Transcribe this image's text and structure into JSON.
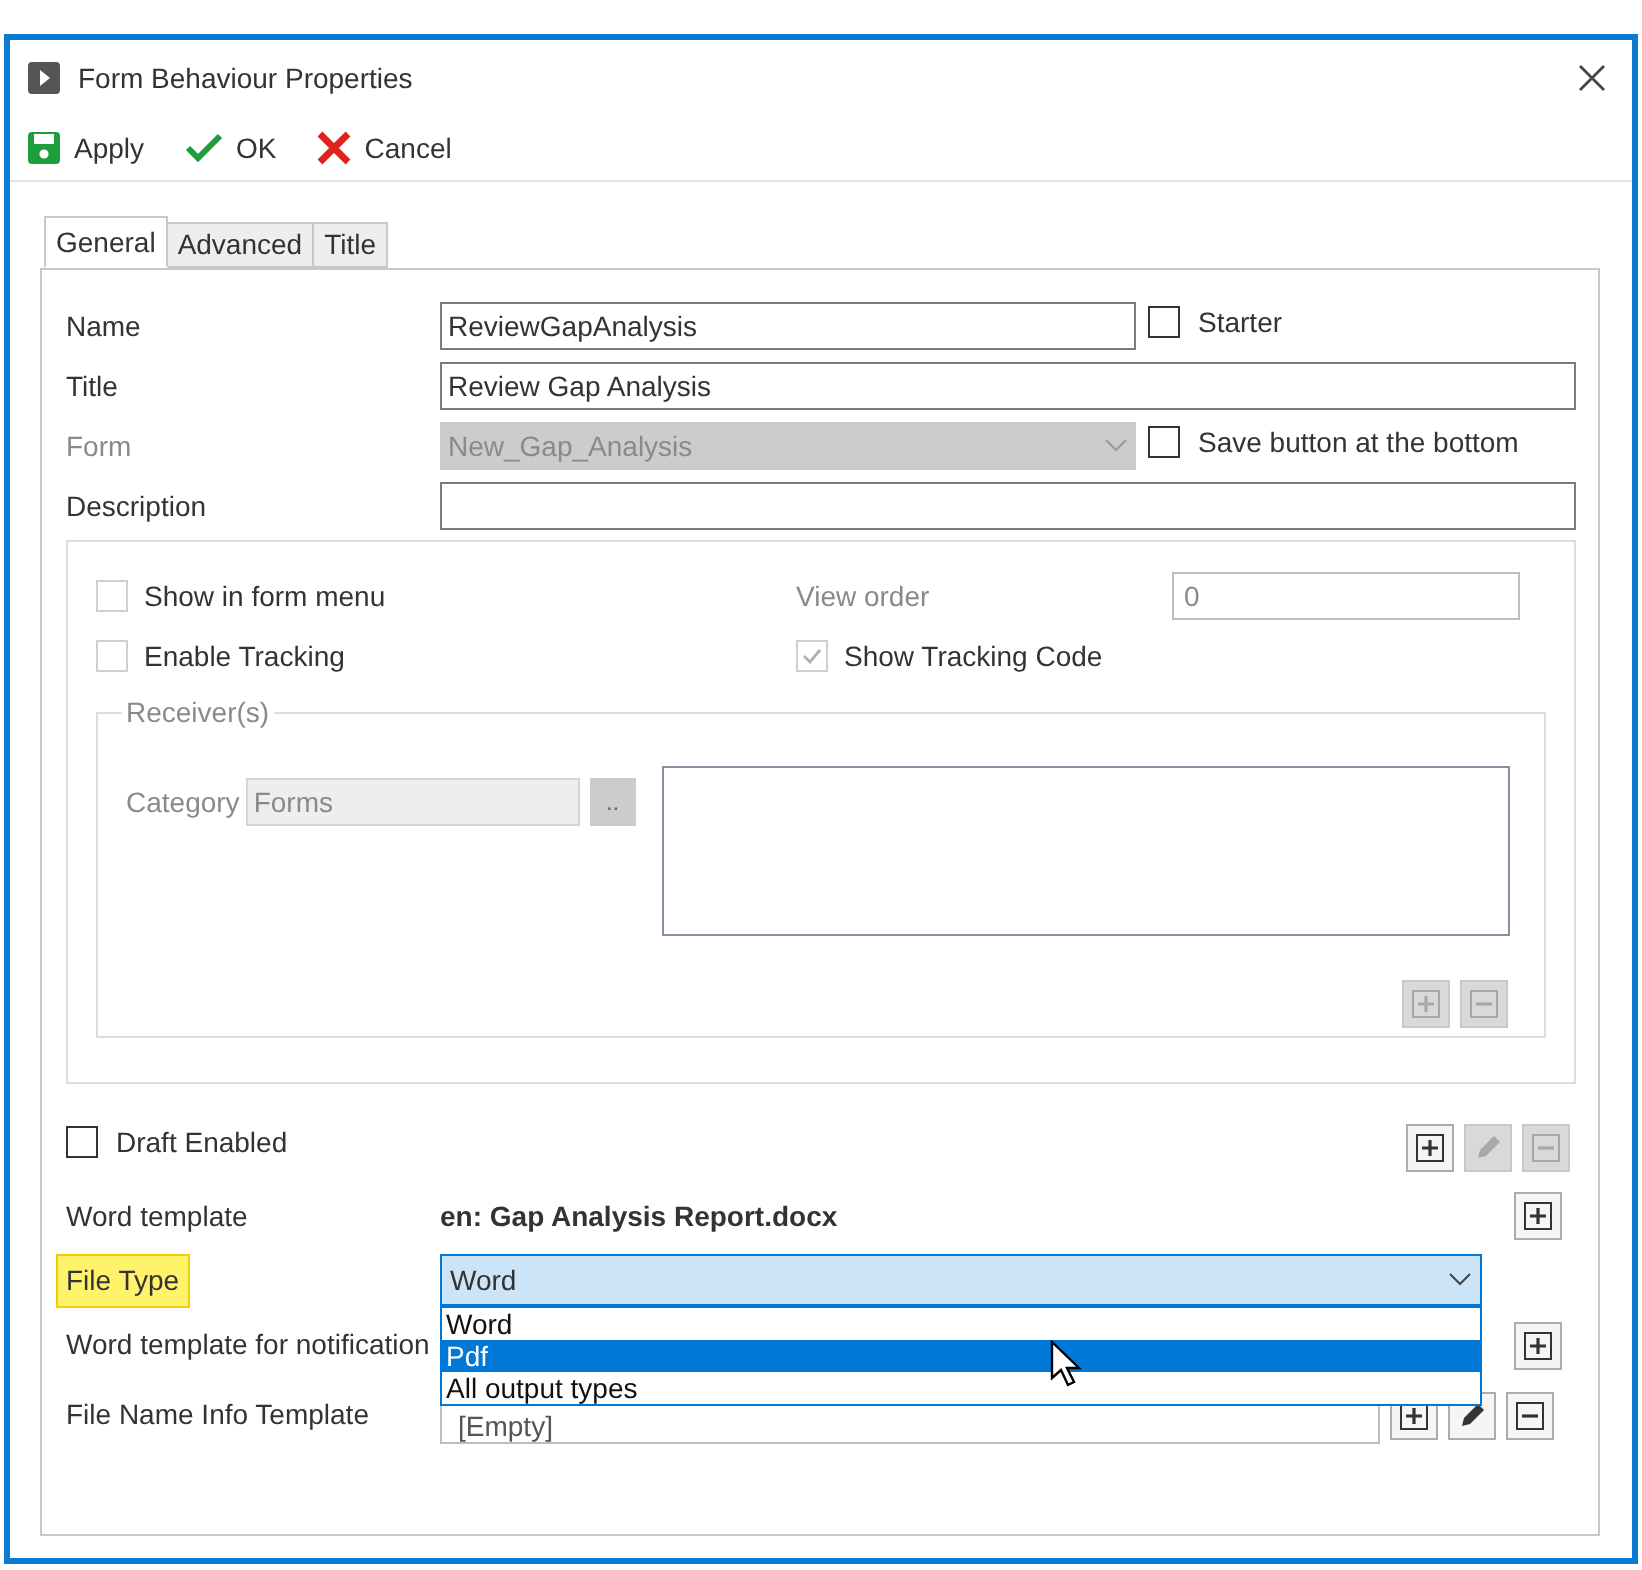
{
  "window": {
    "title": "Form Behaviour Properties"
  },
  "toolbar": [
    {
      "kind": "save",
      "label": "Apply"
    },
    {
      "kind": "ok",
      "label": "OK"
    },
    {
      "kind": "cancel",
      "label": "Cancel"
    }
  ],
  "tabs": [
    {
      "label": "General",
      "selected": true
    },
    {
      "label": "Advanced",
      "selected": false
    },
    {
      "label": "Title",
      "selected": false
    }
  ],
  "fields": [
    {
      "kind": "text",
      "label": "Name",
      "value": "ReviewGapAnalysis",
      "disabled": false,
      "checkbox": {
        "label": "Starter",
        "checked": false
      }
    },
    {
      "kind": "text",
      "label": "Title",
      "value": "Review Gap Analysis",
      "disabled": false
    },
    {
      "kind": "select",
      "label": "Form",
      "value": "New_Gap_Analysis",
      "disabled": true,
      "checkbox": {
        "label": "Save button at the bottom",
        "checked": false
      }
    },
    {
      "kind": "text",
      "label": "Description",
      "disabled": false
    }
  ],
  "group": {
    "checkboxes": [
      {
        "label": "Show in form menu",
        "checked": false,
        "disabled": true
      },
      {
        "label": "Enable Tracking",
        "checked": false,
        "disabled": true
      },
      {
        "label": "Show Tracking Code",
        "checked": true,
        "disabled": true
      }
    ],
    "view_order": {
      "label": "View order",
      "value": "0"
    },
    "receivers": {
      "title": "Receiver(s)",
      "category_label": "Category",
      "category_value": "Forms",
      "browse_label": "..",
      "buttons": [
        {
          "kind": "add",
          "disabled": true
        },
        {
          "kind": "remove",
          "disabled": true
        }
      ]
    }
  },
  "draft": {
    "label": "Draft Enabled",
    "checked": false,
    "buttons": [
      {
        "kind": "add",
        "disabled": false
      },
      {
        "kind": "edit",
        "disabled": true
      },
      {
        "kind": "remove",
        "disabled": true
      }
    ]
  },
  "word_template": {
    "label": "Word template",
    "value": "en: Gap Analysis Report.docx",
    "buttons": [
      {
        "kind": "add",
        "disabled": false
      }
    ]
  },
  "file_type": {
    "label": "File Type",
    "highlighted": true,
    "value": "Word",
    "expanded": true,
    "options": [
      {
        "label": "Word",
        "highlighted": false
      },
      {
        "label": "Pdf",
        "highlighted": true
      },
      {
        "label": "All output types",
        "highlighted": false
      }
    ]
  },
  "notification_template": {
    "label": "Word template for notification",
    "buttons": [
      {
        "kind": "add",
        "disabled": false
      }
    ]
  },
  "file_name_template": {
    "label": "File Name Info Template",
    "value": "[Empty]",
    "buttons": [
      {
        "kind": "add",
        "disabled": false
      },
      {
        "kind": "edit",
        "disabled": false
      },
      {
        "kind": "remove",
        "disabled": false
      }
    ]
  }
}
